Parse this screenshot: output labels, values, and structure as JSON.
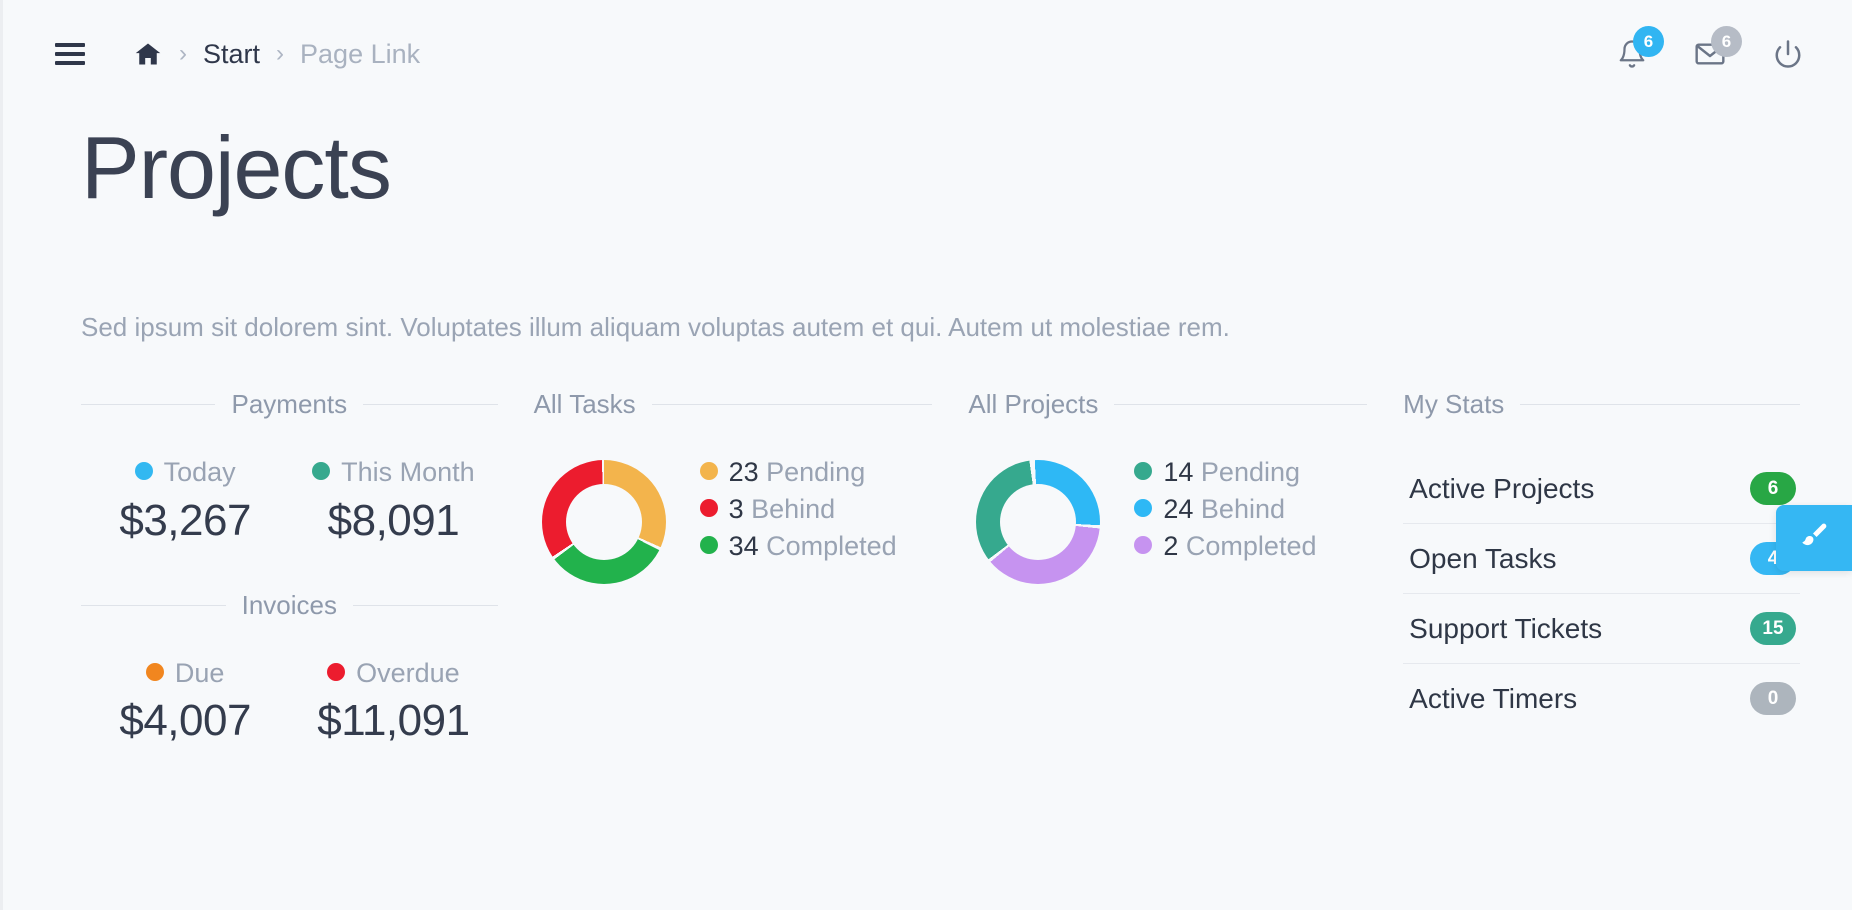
{
  "topbar": {
    "menu_icon": "hamburger-menu-icon",
    "breadcrumb": {
      "home_icon": "home-icon",
      "separator": "›",
      "items": [
        {
          "label": "Start",
          "state": "active"
        },
        {
          "label": "Page Link",
          "state": "muted"
        }
      ]
    },
    "icons": [
      {
        "name": "notifications-bell-icon",
        "badge": "6",
        "badge_color": "#31b5f2"
      },
      {
        "name": "messages-envelope-icon",
        "badge": "6",
        "badge_color": "#b6bcc6"
      },
      {
        "name": "power-logout-icon",
        "badge": null
      }
    ]
  },
  "page": {
    "title": "Projects",
    "description": "Sed ipsum sit dolorem sint. Voluptates illum aliquam voluptas autem et qui. Autem ut molestiae rem."
  },
  "payments": {
    "heading": "Payments",
    "items": [
      {
        "label": "Today",
        "value": "$3,267",
        "color": "#32b8f1"
      },
      {
        "label": "This Month",
        "value": "$8,091",
        "color": "#36a98e"
      }
    ]
  },
  "invoices": {
    "heading": "Invoices",
    "items": [
      {
        "label": "Due",
        "value": "$4,007",
        "color": "#f1861f"
      },
      {
        "label": "Overdue",
        "value": "$11,091",
        "color": "#ec1c2e"
      }
    ]
  },
  "all_tasks": {
    "heading": "All Tasks",
    "legend": [
      {
        "count": "23",
        "label": "Pending",
        "color": "#f3b44c"
      },
      {
        "count": "3",
        "label": "Behind",
        "color": "#ec1c2e"
      },
      {
        "count": "34",
        "label": "Completed",
        "color": "#22b24c"
      }
    ]
  },
  "all_projects": {
    "heading": "All Projects",
    "legend": [
      {
        "count": "14",
        "label": "Pending",
        "color": "#36a98e"
      },
      {
        "count": "24",
        "label": "Behind",
        "color": "#2eb8f5"
      },
      {
        "count": "2",
        "label": "Completed",
        "color": "#c693f0"
      }
    ]
  },
  "my_stats": {
    "heading": "My Stats",
    "rows": [
      {
        "label": "Active Projects",
        "count": "6",
        "color": "#28a745"
      },
      {
        "label": "Open Tasks",
        "count": "4",
        "color": "#35b7f3"
      },
      {
        "label": "Support Tickets",
        "count": "15",
        "color": "#36a98e"
      },
      {
        "label": "Active Timers",
        "count": "0",
        "color": "#adb5bd"
      }
    ]
  },
  "theme_tab": {
    "icon": "paint-brush-icon",
    "color": "#35b7f3"
  },
  "chart_data": [
    {
      "type": "pie",
      "title": "All Tasks",
      "labels": [
        "Pending",
        "Behind",
        "Completed"
      ],
      "values": [
        23,
        3,
        34
      ],
      "colors": [
        "#f3b44c",
        "#ec1c2e",
        "#22b24c"
      ],
      "arcs_deg": [
        [
          0,
          115
        ],
        [
          235,
          360
        ],
        [
          115,
          235
        ]
      ],
      "legend": "right",
      "donut": true
    },
    {
      "type": "pie",
      "title": "All Projects",
      "labels": [
        "Pending",
        "Behind",
        "Completed"
      ],
      "values": [
        14,
        24,
        2
      ],
      "colors": [
        "#36a98e",
        "#2eb8f5",
        "#c693f0"
      ],
      "arcs_deg": [
        [
          233,
          352
        ],
        [
          3,
          93
        ],
        [
          96,
          230
        ]
      ],
      "legend": "right",
      "donut": true
    }
  ]
}
